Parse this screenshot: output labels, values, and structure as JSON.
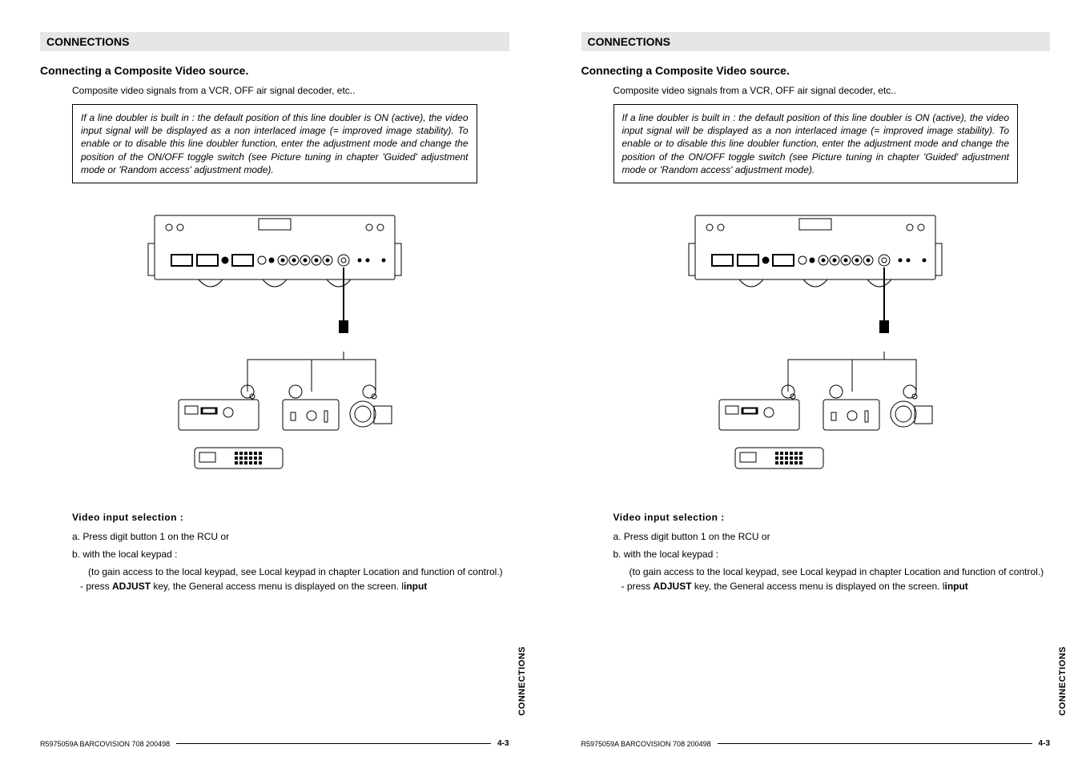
{
  "header": "CONNECTIONS",
  "subheading": "Connecting a Composite Video source.",
  "intro": "Composite video signals from a VCR, OFF air signal decoder, etc..",
  "note": "If a line doubler is built in : the default position of this line doubler is ON (active), the video input signal will be displayed as a non interlaced image (= improved image stability). To enable or to disable this line doubler function, enter the adjustment mode and change the position of the ON/OFF toggle switch (see Picture tuning in chapter 'Guided' adjustment mode or 'Random access' adjustment mode).",
  "section_label": "Video input selection :",
  "step_a": "a. Press digit button 1 on the RCU or",
  "step_b": "b. with the local keypad :",
  "step_sub1": "(to gain access to the local keypad, see Local keypad in chapter Location and function of control.)",
  "step_sub2_pre": "- press ",
  "step_sub2_key": "ADJUST",
  "step_sub2_mid": " key, the General access menu is displayed on the screen. l",
  "step_sub2_bold": "input",
  "footer_left": "R5975059A BARCOVISION 708 200498",
  "footer_right": "4-3",
  "vlabel": "CONNECTIONS"
}
